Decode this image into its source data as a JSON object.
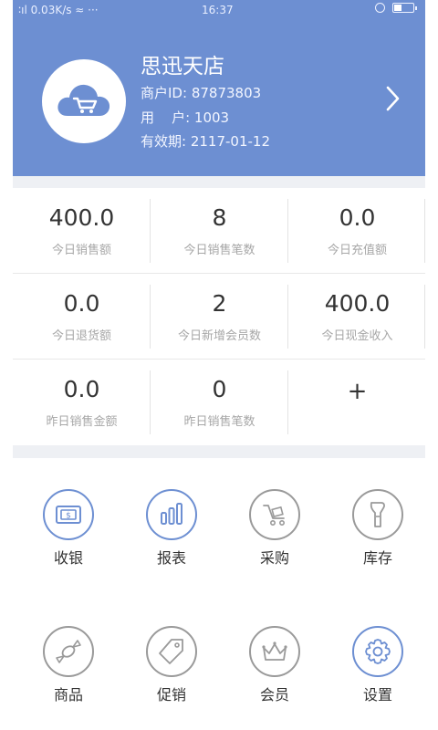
{
  "status_bar": {
    "left": "∶ıl 0.03K/s ≈ ···",
    "time": "16:37"
  },
  "shop": {
    "name": "思迅天店",
    "merchant_label": "商户ID:",
    "merchant_id": "87873803",
    "user_label": "用    户:",
    "user_id": "1003",
    "valid_label": "有效期:",
    "valid_date": "2117-01-12"
  },
  "stats": [
    {
      "value": "400.0",
      "label": "今日销售额"
    },
    {
      "value": "8",
      "label": "今日销售笔数"
    },
    {
      "value": "0.0",
      "label": "今日充值额"
    },
    {
      "value": "0.0",
      "label": "今日退货额"
    },
    {
      "value": "2",
      "label": "今日新增会员数"
    },
    {
      "value": "400.0",
      "label": "今日现金收入"
    },
    {
      "value": "0.0",
      "label": "昨日销售金额"
    },
    {
      "value": "0",
      "label": "昨日销售笔数"
    }
  ],
  "add_stat": "+",
  "menu": [
    {
      "label": "收银",
      "icon": "cashier-icon"
    },
    {
      "label": "报表",
      "icon": "report-icon"
    },
    {
      "label": "采购",
      "icon": "purchase-cart-icon"
    },
    {
      "label": "库存",
      "icon": "inventory-icon"
    },
    {
      "label": "商品",
      "icon": "goods-candy-icon"
    },
    {
      "label": "促销",
      "icon": "promotion-tag-icon"
    },
    {
      "label": "会员",
      "icon": "member-crown-icon"
    },
    {
      "label": "设置",
      "icon": "settings-gear-icon"
    }
  ],
  "colors": {
    "header": "#6d8fd2",
    "accent_icon": "#6d8fd2",
    "grey_icon": "#9a9a9a"
  }
}
